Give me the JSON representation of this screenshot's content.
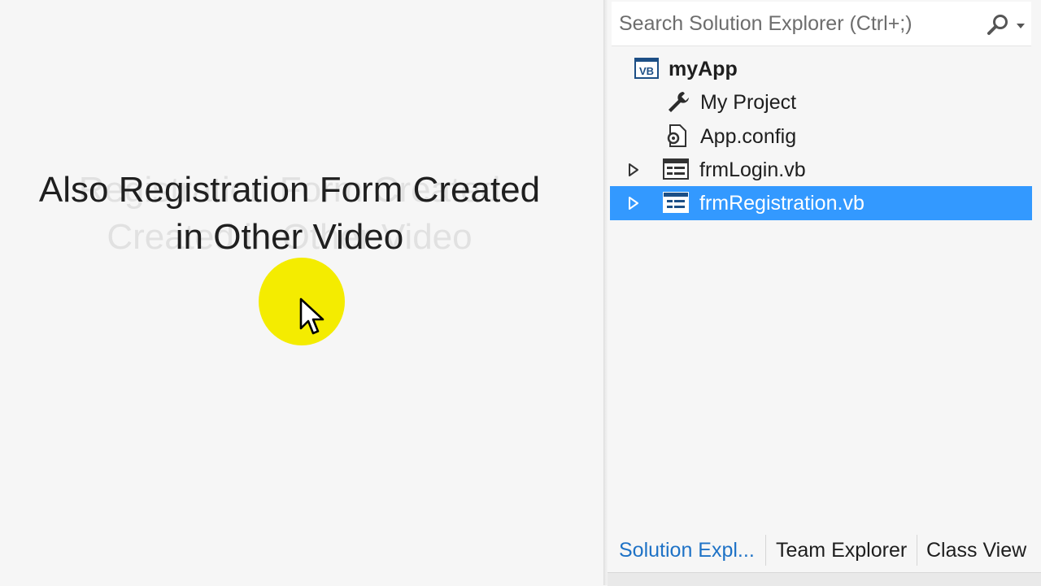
{
  "caption": {
    "line1": "Also Registration Form Created",
    "line2": "in Other Video",
    "ghost_line1": "Registration Form Created",
    "ghost_line2": "Created in Other Video"
  },
  "search": {
    "placeholder": "Search Solution Explorer (Ctrl+;)",
    "icon": "search-icon"
  },
  "tree": {
    "root": {
      "label": "myApp",
      "icon": "vb-project-icon"
    },
    "items": [
      {
        "label": "My Project",
        "icon": "wrench-icon"
      },
      {
        "label": "App.config",
        "icon": "config-file-icon"
      },
      {
        "label": "frmLogin.vb",
        "icon": "form-icon"
      },
      {
        "label": "frmRegistration.vb",
        "icon": "form-icon",
        "selected": true
      }
    ]
  },
  "tabs": [
    {
      "label": "Solution Expl...",
      "active": true
    },
    {
      "label": "Team Explorer",
      "active": false
    },
    {
      "label": "Class View",
      "active": false
    }
  ],
  "colors": {
    "selection": "#3399ff",
    "active_tab": "#1e72c6",
    "cursor_highlight": "#f4ec00"
  }
}
